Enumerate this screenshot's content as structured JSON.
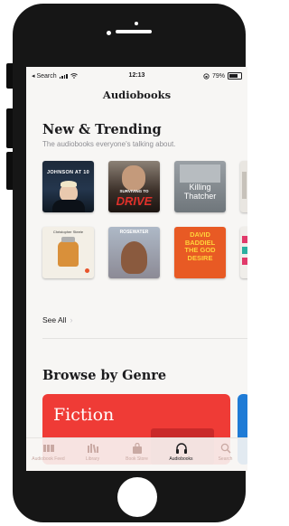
{
  "status_bar": {
    "back_label": "◂ Search",
    "time": "12:13",
    "battery_text": "79%",
    "battery_level": 0.79
  },
  "nav": {
    "title": "Audiobooks"
  },
  "new_trending": {
    "title": "New & Trending",
    "subtitle": "The audiobooks everyone's talking about.",
    "row1": [
      {
        "text": "JOHNSON AT 10"
      },
      {
        "text_top": "SURVIVING TO",
        "text_main": "DRIVE"
      },
      {
        "text": "Killing Thatcher"
      }
    ],
    "row2": [
      {
        "text": "Christopher Steele"
      },
      {
        "text": "ROSEWATER"
      },
      {
        "text": "DAVID BADDIEL THE GOD DESIRE"
      }
    ],
    "see_all": "See All"
  },
  "browse": {
    "title": "Browse by Genre",
    "genre_label": "Fiction"
  },
  "tab_bar": {
    "tabs": [
      {
        "label": "Audiobook Feed",
        "icon": "shelf-icon"
      },
      {
        "label": "Library",
        "icon": "library-icon"
      },
      {
        "label": "Book Store",
        "icon": "bag-icon"
      },
      {
        "label": "Audiobooks",
        "icon": "headphones-icon"
      },
      {
        "label": "Search",
        "icon": "search-icon"
      }
    ]
  },
  "colors": {
    "accent": "#ef3b36",
    "tab_inactive": "#c9a9a3",
    "background": "#f7f6f4",
    "frame": "#161616"
  }
}
